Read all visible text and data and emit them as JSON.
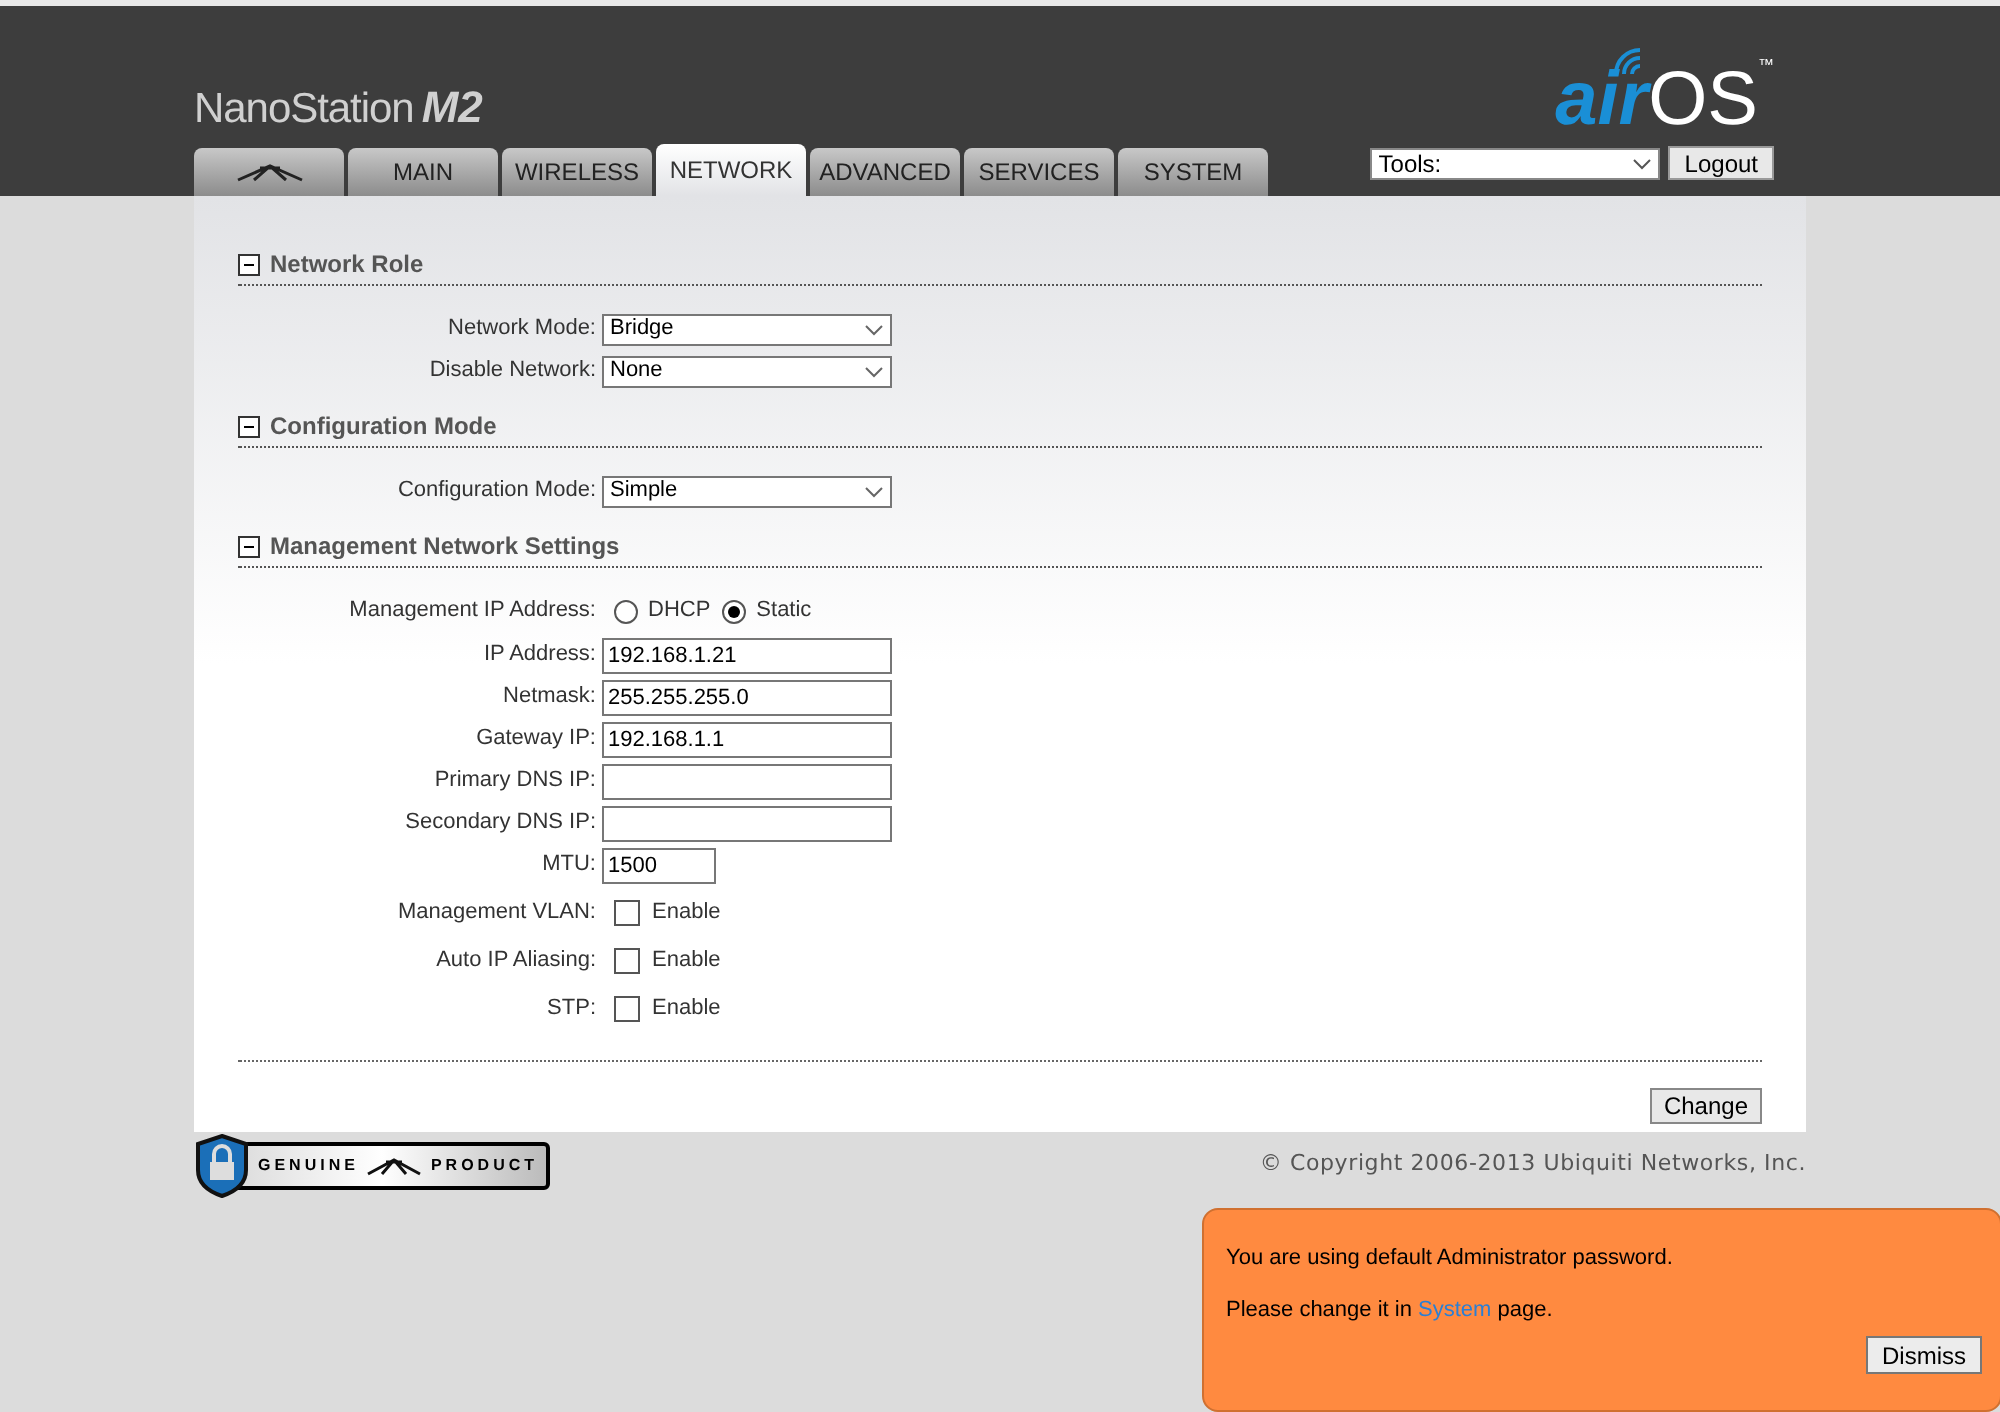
{
  "brand": {
    "product": "NanoStation",
    "model": "M2",
    "os_air": "air",
    "os_name": "OS",
    "trademark": "™"
  },
  "tabs": [
    {
      "kind": "logo",
      "selected": false
    },
    {
      "kind": "text",
      "label": "MAIN",
      "selected": false
    },
    {
      "kind": "text",
      "label": "WIRELESS",
      "selected": false
    },
    {
      "kind": "text",
      "label": "NETWORK",
      "selected": true
    },
    {
      "kind": "text",
      "label": "ADVANCED",
      "selected": false
    },
    {
      "kind": "text",
      "label": "SERVICES",
      "selected": false
    },
    {
      "kind": "text",
      "label": "SYSTEM",
      "selected": false
    }
  ],
  "tools": {
    "value": "Tools:"
  },
  "logout": "Logout",
  "sections": [
    {
      "title": "Network Role",
      "expanded": true,
      "rows": [
        {
          "kind": "select",
          "label": "Network Mode:",
          "value": "Bridge"
        },
        {
          "kind": "select",
          "label": "Disable Network:",
          "value": "None"
        }
      ]
    },
    {
      "title": "Configuration Mode",
      "expanded": true,
      "rows": [
        {
          "kind": "select",
          "label": "Configuration Mode:",
          "value": "Simple"
        }
      ]
    },
    {
      "title": "Management Network Settings",
      "expanded": true,
      "rows": [
        {
          "kind": "radio",
          "label": "Management IP Address:",
          "options": [
            {
              "label": "DHCP",
              "selected": false
            },
            {
              "label": "Static",
              "selected": true
            }
          ]
        },
        {
          "kind": "text",
          "label": "IP Address:",
          "value": "192.168.1.21"
        },
        {
          "kind": "text",
          "label": "Netmask:",
          "value": "255.255.255.0"
        },
        {
          "kind": "text",
          "label": "Gateway IP:",
          "value": "192.168.1.1"
        },
        {
          "kind": "text",
          "label": "Primary DNS IP:",
          "value": ""
        },
        {
          "kind": "text",
          "label": "Secondary DNS IP:",
          "value": ""
        },
        {
          "kind": "short",
          "label": "MTU:",
          "value": "1500"
        },
        {
          "kind": "checkbox",
          "label": "Management VLAN:",
          "option": "Enable",
          "checked": false
        },
        {
          "kind": "checkbox",
          "label": "Auto IP Aliasing:",
          "option": "Enable",
          "checked": false
        },
        {
          "kind": "checkbox",
          "label": "STP:",
          "option": "Enable",
          "checked": false
        }
      ]
    }
  ],
  "change_button": "Change",
  "badge": {
    "left": "GENUINE",
    "right": "PRODUCT"
  },
  "copyright": "© Copyright 2006-2013 Ubiquiti Networks, Inc.",
  "notice": {
    "line1": "You are using default Administrator password.",
    "line2_before": "Please change it in ",
    "line2_link": "System",
    "line2_after": " page.",
    "dismiss": "Dismiss"
  }
}
